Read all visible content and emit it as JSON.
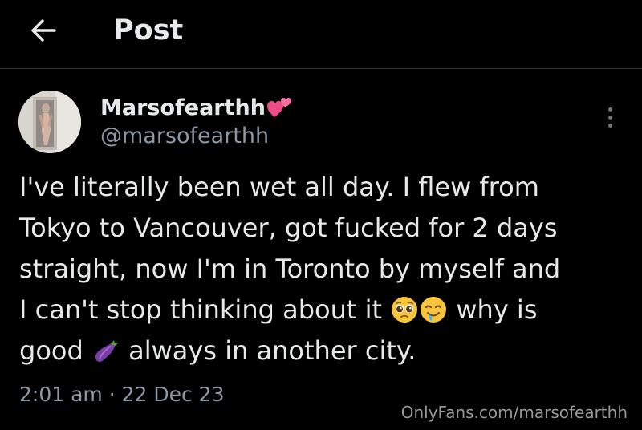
{
  "header": {
    "title": "Post",
    "back_icon": "arrow-left-icon"
  },
  "post": {
    "author": {
      "display_name": "Marsofearthh",
      "name_emoji": "two-hearts-emoji",
      "handle": "@marsofearthh"
    },
    "more_icon": "more-vertical-icon",
    "text_lines": [
      "I've literally been wet all day. I flew from",
      "Tokyo to Vancouver, got fucked for 2 days",
      "straight, now I'm in Toronto by myself and",
      "I can't stop thinking about it",
      "why is",
      "good",
      "always in another city."
    ],
    "emojis": [
      "pleading-face-emoji",
      "drooling-face-emoji",
      "eggplant-emoji"
    ],
    "timestamp": "2:01 am · 22 Dec 23"
  },
  "watermark": "OnlyFans.com/marsofearthh",
  "colors": {
    "background": "#000000",
    "text_primary": "#e7e9ea",
    "text_secondary": "#8b98a5",
    "divider": "#2f3336"
  }
}
